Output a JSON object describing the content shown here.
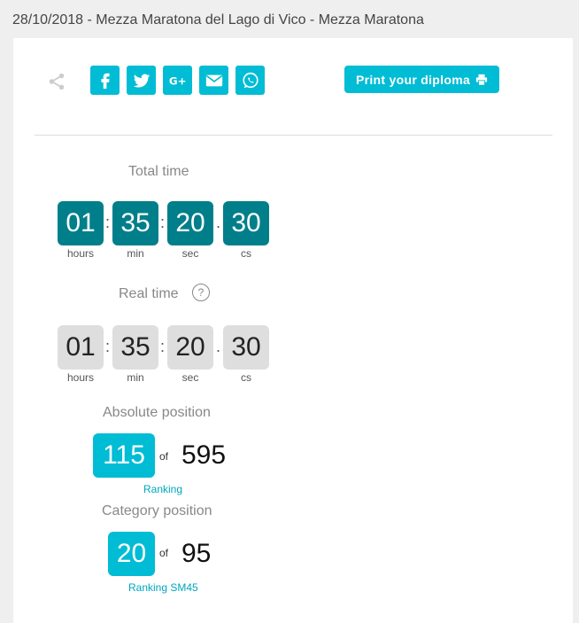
{
  "page": {
    "title": "28/10/2018 - Mezza Maratona del Lago di Vico - Mezza Maratona"
  },
  "share": {
    "icons": [
      "share-icon",
      "facebook-icon",
      "twitter-icon",
      "google-plus-icon",
      "email-icon",
      "whatsapp-icon"
    ],
    "print_label": "Print your diploma",
    "accent_color": "#00bcd4"
  },
  "total_time": {
    "label": "Total time",
    "hours": "01",
    "min": "35",
    "sec": "20",
    "cs": "30",
    "color": "#007f8a"
  },
  "real_time": {
    "label": "Real time",
    "help": "?",
    "hours": "01",
    "min": "35",
    "sec": "20",
    "cs": "30",
    "color": "#dedede"
  },
  "units": {
    "hours": "hours",
    "min": "min",
    "sec": "sec",
    "cs": "cs"
  },
  "separators": {
    "colon": ":",
    "dot": "."
  },
  "absolute_position": {
    "label": "Absolute position",
    "value": "115",
    "of": "of",
    "total": "595",
    "link": "Ranking"
  },
  "category_position": {
    "label": "Category position",
    "value": "20",
    "of": "of",
    "total": "95",
    "link": "Ranking SM45"
  }
}
